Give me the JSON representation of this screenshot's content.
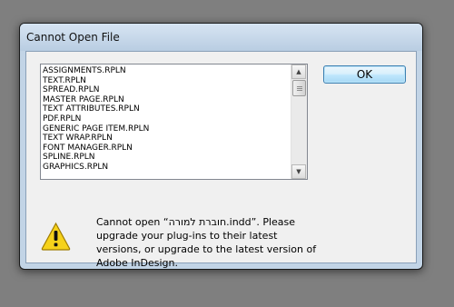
{
  "window": {
    "title": "Cannot Open File"
  },
  "files": {
    "items": [
      "ASSIGNMENTS.RPLN",
      "TEXT.RPLN",
      "SPREAD.RPLN",
      "MASTER PAGE.RPLN",
      "TEXT ATTRIBUTES.RPLN",
      "PDF.RPLN",
      "GENERIC PAGE ITEM.RPLN",
      "TEXT WRAP.RPLN",
      "FONT MANAGER.RPLN",
      "SPLINE.RPLN",
      "GRAPHICS.RPLN"
    ]
  },
  "buttons": {
    "ok_label": "OK"
  },
  "message": {
    "text": "Cannot open “חוברת למורה.indd”. Please upgrade your plug-ins to their latest versions, or upgrade to the latest version of Adobe InDesign."
  },
  "icons": {
    "warning": "warning-icon",
    "scroll_up": "scroll-up-icon",
    "scroll_down": "scroll-down-icon"
  },
  "colors": {
    "warning_fill": "#f6d21b",
    "ok_border": "#3c7fb1"
  }
}
